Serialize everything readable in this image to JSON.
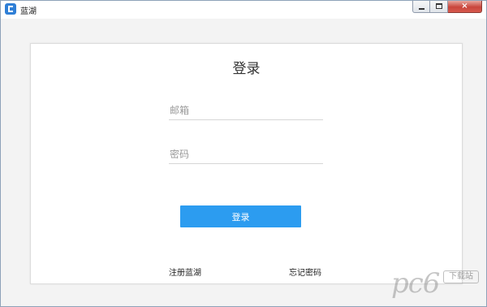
{
  "window": {
    "title": "蓝湖",
    "icon": "lanhu-app-icon",
    "controls": {
      "minimize": "minimize-icon",
      "maximize": "maximize-icon",
      "close": "×"
    }
  },
  "login": {
    "heading": "登录",
    "email_placeholder": "邮箱",
    "email_value": "",
    "password_placeholder": "密码",
    "password_value": "",
    "submit_label": "登录",
    "register_link": "注册蓝湖",
    "forgot_link": "忘记密码"
  },
  "watermark": {
    "text": "pc6",
    "badge": "下载站"
  },
  "colors": {
    "accent": "#2c9cf0",
    "panel": "#ffffff",
    "background": "#f3f3f3"
  }
}
